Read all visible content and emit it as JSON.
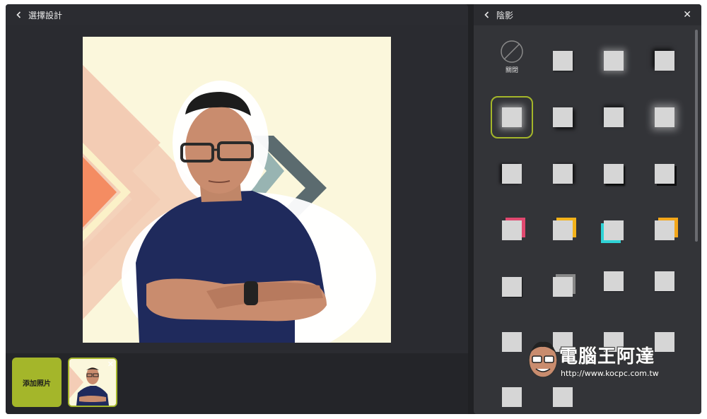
{
  "editor": {
    "back_icon": "chevron-left-icon",
    "title": "選擇設計",
    "expand_icon": "chevron-down-icon"
  },
  "tray": {
    "add_photo_label": "添加照片",
    "remove_icon": "close-icon"
  },
  "panel": {
    "back_icon": "chevron-left-icon",
    "title": "陰影",
    "close_icon": "close-icon",
    "off_label": "關閉",
    "selected_index": 4
  },
  "watermark": {
    "text": "電腦王阿達",
    "url": "http://www.kocpc.com.tw"
  },
  "colors": {
    "accent": "#a4b62a",
    "panel_bg": "#333438",
    "editor_bg": "#2b2c31"
  }
}
